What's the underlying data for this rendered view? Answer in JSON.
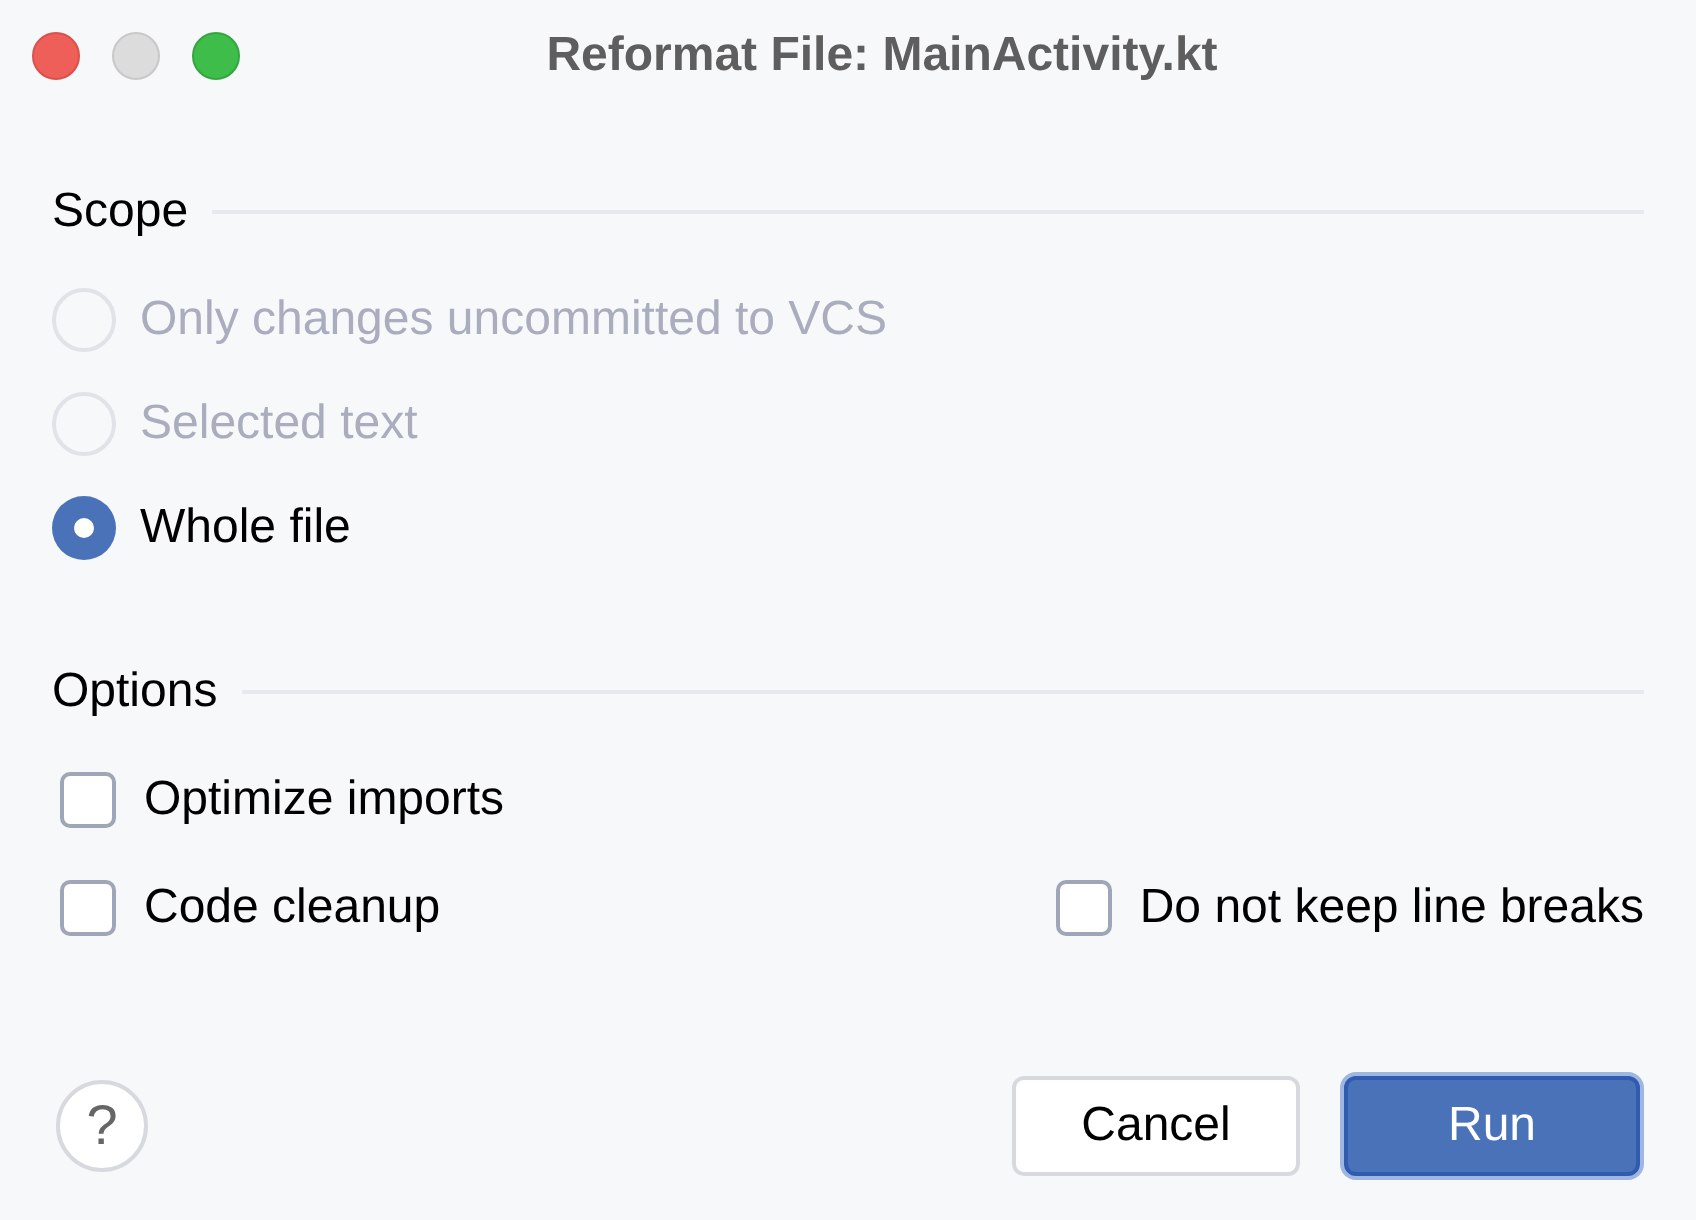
{
  "window": {
    "title": "Reformat File: MainActivity.kt"
  },
  "scope": {
    "heading": "Scope",
    "options": [
      {
        "label": "Only changes uncommitted to VCS",
        "selected": false,
        "disabled": true
      },
      {
        "label": "Selected text",
        "selected": false,
        "disabled": true
      },
      {
        "label": "Whole file",
        "selected": true,
        "disabled": false
      }
    ]
  },
  "options": {
    "heading": "Options",
    "rows": [
      [
        {
          "label": "Optimize imports",
          "checked": false
        }
      ],
      [
        {
          "label": "Code cleanup",
          "checked": false
        },
        {
          "label": "Do not keep line breaks",
          "checked": false
        }
      ]
    ]
  },
  "help": "?",
  "buttons": [
    {
      "label": "Cancel",
      "kind": "secondary"
    },
    {
      "label": "Run",
      "kind": "primary"
    }
  ]
}
